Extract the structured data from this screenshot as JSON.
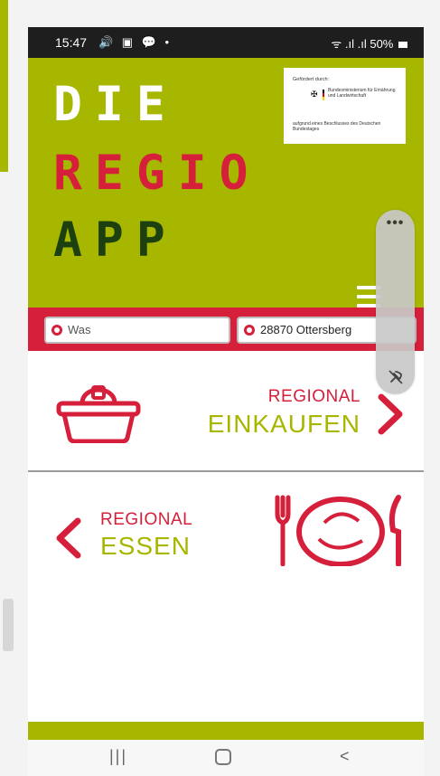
{
  "status_bar": {
    "time": "15:47",
    "left_icons": "🔊 ▣ 💬 •",
    "battery": "50%",
    "signal": "ᯤ .ıl .ıl"
  },
  "header": {
    "logo_line1": "DIE",
    "logo_line2": "REGIO",
    "logo_line3": "APP",
    "funding": {
      "top_text": "Gefördert durch:",
      "ministry": "Bundesministerium für Ernährung und Landwirtschaft",
      "bottom_text": "aufgrund eines Beschlusses des Deutschen Bundestages"
    }
  },
  "search": {
    "what_value": "Was",
    "where_value": "28870 Ottersberg"
  },
  "tiles": {
    "einkaufen": {
      "small": "REGIONAL",
      "big": "EINKAUFEN"
    },
    "essen": {
      "small": "REGIONAL",
      "big": "ESSEN"
    }
  },
  "overlay": {
    "more": "•••"
  },
  "nav": {
    "recent": "|||",
    "back": "<"
  },
  "colors": {
    "green": "#a7b700",
    "red": "#d61f3a",
    "dark_green": "#1d4011"
  }
}
